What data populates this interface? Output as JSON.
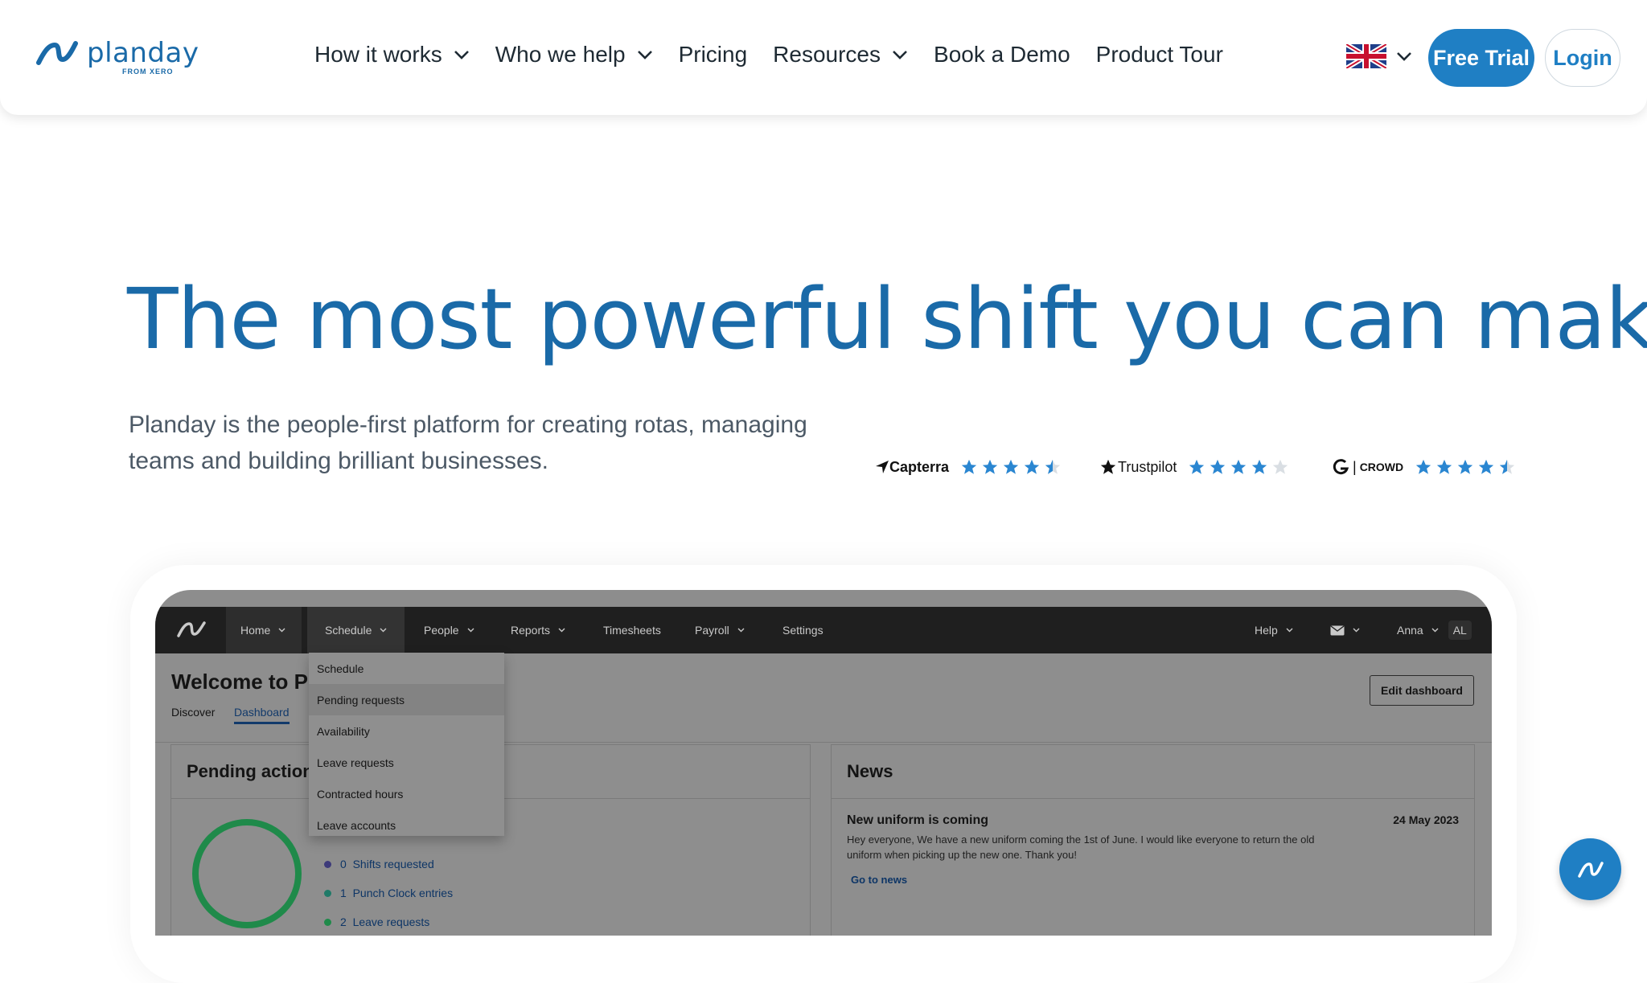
{
  "header": {
    "logo_name": "planday",
    "logo_sub": "FROM XERO",
    "nav": [
      {
        "label": "How it works",
        "has_dropdown": true
      },
      {
        "label": "Who we help",
        "has_dropdown": true
      },
      {
        "label": "Pricing",
        "has_dropdown": false
      },
      {
        "label": "Resources",
        "has_dropdown": true
      },
      {
        "label": "Book a Demo",
        "has_dropdown": false
      },
      {
        "label": "Product Tour",
        "has_dropdown": false
      }
    ],
    "language_icon": "uk-flag-icon",
    "free_trial_label": "Free Trial",
    "login_label": "Login"
  },
  "hero": {
    "title": "The most powerful shift you can make.",
    "subtitle": "Planday is the people-first platform for creating rotas, managing teams and building brilliant businesses.",
    "ratings": [
      {
        "brand": "Capterra",
        "stars": 4.5
      },
      {
        "brand": "Trustpilot",
        "stars": 4
      },
      {
        "brand": "CROWD",
        "stars": 4.5
      }
    ]
  },
  "app": {
    "nav": [
      {
        "label": "Home"
      },
      {
        "label": "Schedule"
      },
      {
        "label": "People"
      },
      {
        "label": "Reports"
      },
      {
        "label": "Timesheets"
      },
      {
        "label": "Payroll"
      },
      {
        "label": "Settings"
      }
    ],
    "help_label": "Help",
    "user_name": "Anna",
    "user_initials": "AL",
    "welcome": "Welcome to Pla",
    "tabs": [
      "Discover",
      "Dashboard"
    ],
    "edit_dashboard_label": "Edit dashboard",
    "schedule_menu": [
      "Schedule",
      "Pending requests",
      "Availability",
      "Leave requests",
      "Contracted hours",
      "Leave accounts"
    ],
    "pending_title": "Pending actions",
    "pending_items": [
      {
        "count": "0",
        "label": "Shifts requested",
        "color": "#3d3a7a"
      },
      {
        "count": "1",
        "label": "Punch Clock entries",
        "color": "#1f7a68"
      },
      {
        "count": "2",
        "label": "Leave requests",
        "color": "#1f8a4a"
      }
    ],
    "news_title": "News",
    "news_item": {
      "title": "New uniform is coming",
      "date": "24 May 2023",
      "body": "Hey everyone, We have a new uniform coming the 1st of June. I would like everyone to return the old uniform when picking up the new one. Thank you!",
      "link": "Go to news"
    }
  },
  "colors": {
    "brand_blue": "#1a6aa8",
    "button_blue": "#1f7fc4",
    "star_blue": "#2a86d1"
  }
}
